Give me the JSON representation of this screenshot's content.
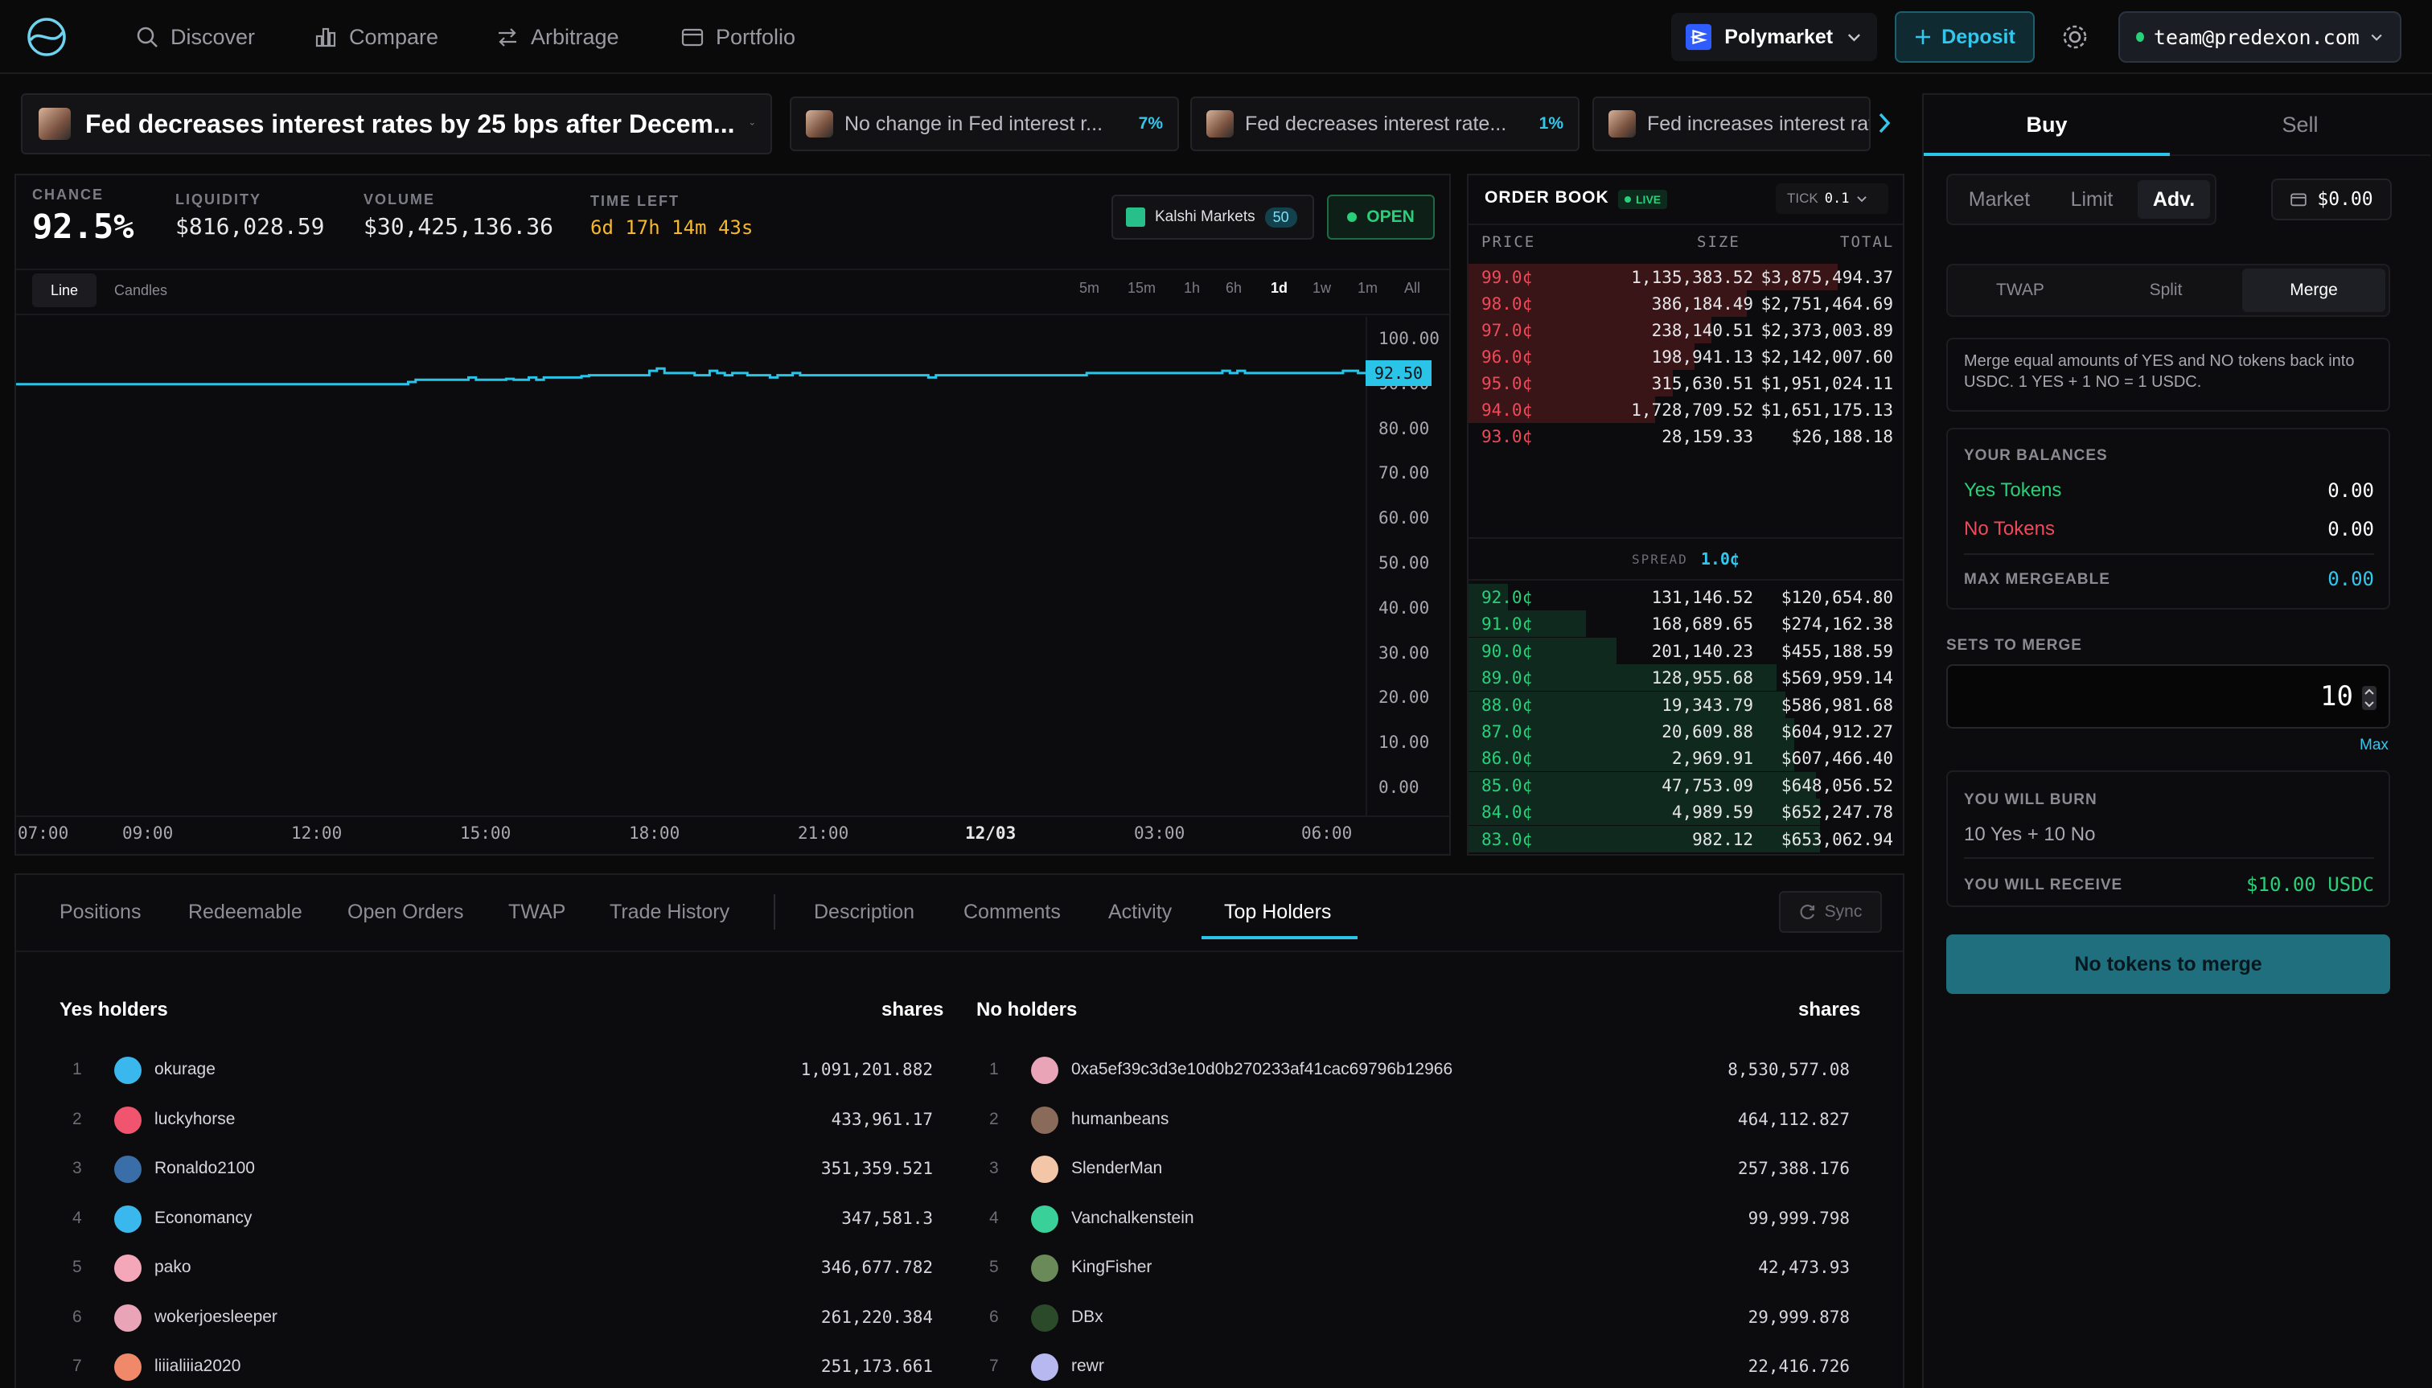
{
  "nav": {
    "links": [
      {
        "label": "Discover",
        "icon": "search-icon"
      },
      {
        "label": "Compare",
        "icon": "bar-chart-icon"
      },
      {
        "label": "Arbitrage",
        "icon": "swap-arrows-icon"
      },
      {
        "label": "Portfolio",
        "icon": "wallet-icon"
      }
    ],
    "platform": "Polymarket",
    "deposit_label": "Deposit",
    "account": "team@predexon.com"
  },
  "markets": {
    "selected": "Fed decreases interest rates by 25 bps after Decem...",
    "others": [
      {
        "title": "No change in Fed interest r...",
        "pct": "7%"
      },
      {
        "title": "Fed decreases interest rate...",
        "pct": "1%"
      },
      {
        "title": "Fed increases interest rat",
        "pct": ""
      }
    ]
  },
  "stats": {
    "chance_label": "CHANCE",
    "chance": "92.5%",
    "liquidity_label": "LIQUIDITY",
    "liquidity": "$816,028.59",
    "volume_label": "VOLUME",
    "volume": "$30,425,136.36",
    "time_label": "TIME LEFT",
    "time_left": "6d 17h 14m 43s",
    "kalshi_label": "Kalshi Markets",
    "kalshi_count": "50",
    "status": "OPEN"
  },
  "chart_controls": {
    "modes": [
      "Line",
      "Candles"
    ],
    "active_mode": "Line",
    "timeframes": [
      "5m",
      "15m",
      "1h",
      "6h",
      "1d",
      "1w",
      "1m",
      "All"
    ],
    "active_timeframe": "1d"
  },
  "chart_data": {
    "type": "line",
    "title": "",
    "xlabel": "",
    "ylabel": "",
    "x_ticks": [
      "07:00",
      "09:00",
      "12:00",
      "15:00",
      "18:00",
      "21:00",
      "12/03",
      "03:00",
      "06:00"
    ],
    "y_ticks": [
      "100.00",
      "90.00",
      "80.00",
      "70.00",
      "60.00",
      "50.00",
      "40.00",
      "30.00",
      "20.00",
      "10.00",
      "0.00"
    ],
    "ylim": [
      0,
      100
    ],
    "color": "#29c4e8",
    "current_value_label": "92.50",
    "series": [
      {
        "values": [
          90.0,
          90.0,
          90.0,
          90.0,
          90.0,
          90.0,
          90.0,
          90.0,
          90.0,
          90.0,
          90.0,
          90.0,
          90.0,
          90.0,
          90.0,
          90.0,
          90.0,
          90.0,
          90.0,
          90.0,
          90.0,
          90.0,
          90.0,
          90.0,
          90.0,
          90.0,
          90.0,
          90.0,
          90.0,
          90.0,
          90.0,
          90.0,
          90.0,
          90.0,
          90.0,
          90.0,
          90.0,
          90.0,
          90.0,
          90.0,
          90.0,
          90.0,
          90.0,
          90.0,
          90.0,
          90.0,
          90.0,
          90.0,
          90.0,
          90.0,
          90.0,
          90.0,
          90.5,
          91.0,
          91.0,
          91.0,
          91.0,
          91.0,
          91.0,
          91.0,
          91.5,
          91.0,
          91.0,
          91.0,
          91.0,
          91.2,
          91.0,
          91.0,
          91.5,
          91.0,
          91.5,
          91.5,
          91.5,
          91.5,
          91.5,
          91.8,
          92.0,
          92.0,
          92.0,
          92.0,
          92.0,
          92.0,
          92.0,
          92.0,
          93.0,
          93.5,
          92.5,
          92.5,
          92.5,
          92.5,
          92.0,
          92.0,
          93.0,
          92.5,
          92.0,
          92.5,
          92.5,
          92.0,
          92.0,
          92.0,
          91.5,
          92.0,
          92.0,
          92.5,
          92.0,
          92.0,
          92.0,
          92.0,
          92.0,
          92.0,
          92.0,
          92.0,
          92.0,
          92.0,
          92.0,
          92.0,
          92.0,
          92.0,
          92.0,
          92.0,
          92.0,
          91.5,
          92.0,
          92.0,
          92.0,
          92.0,
          92.0,
          92.0,
          92.0,
          92.0,
          92.0,
          92.0,
          92.0,
          92.0,
          92.0,
          92.0,
          92.0,
          92.0,
          92.0,
          92.0,
          92.0,
          92.0,
          92.5,
          92.5,
          92.5,
          92.5,
          92.5,
          92.5,
          92.5,
          92.5,
          92.5,
          92.5,
          92.5,
          92.5,
          92.5,
          92.5,
          92.5,
          92.5,
          92.5,
          92.5,
          93.0,
          92.5,
          93.0,
          92.5,
          92.5,
          92.5,
          92.5,
          92.5,
          92.5,
          92.5,
          92.5,
          92.5,
          92.5,
          92.5,
          92.5,
          92.5,
          93.0,
          93.0,
          92.5,
          92.5
        ]
      }
    ]
  },
  "orderbook": {
    "title": "ORDER BOOK",
    "live": "LIVE",
    "tick_label": "TICK",
    "tick": "0.1",
    "headers": [
      "PRICE",
      "SIZE",
      "TOTAL"
    ],
    "asks": [
      {
        "price": "99.0¢",
        "size": "1,135,383.52",
        "total": "$3,875,494.37",
        "depth": 0.85
      },
      {
        "price": "98.0¢",
        "size": "386,184.49",
        "total": "$2,751,464.69",
        "depth": 0.64
      },
      {
        "price": "97.0¢",
        "size": "238,140.51",
        "total": "$2,373,003.89",
        "depth": 0.56
      },
      {
        "price": "96.0¢",
        "size": "198,941.13",
        "total": "$2,142,007.60",
        "depth": 0.52
      },
      {
        "price": "95.0¢",
        "size": "315,630.51",
        "total": "$1,951,024.11",
        "depth": 0.47
      },
      {
        "price": "94.0¢",
        "size": "1,728,709.52",
        "total": "$1,651,175.13",
        "depth": 0.43
      },
      {
        "price": "93.0¢",
        "size": "28,159.33",
        "total": "$26,188.18",
        "depth": 0.0
      }
    ],
    "spread_label": "SPREAD",
    "spread": "1.0¢",
    "bids": [
      {
        "price": "92.0¢",
        "size": "131,146.52",
        "total": "$120,654.80",
        "depth": 0.09
      },
      {
        "price": "91.0¢",
        "size": "168,689.65",
        "total": "$274,162.38",
        "depth": 0.27
      },
      {
        "price": "90.0¢",
        "size": "201,140.23",
        "total": "$455,188.59",
        "depth": 0.34
      },
      {
        "price": "89.0¢",
        "size": "128,955.68",
        "total": "$569,959.14",
        "depth": 0.71
      },
      {
        "price": "88.0¢",
        "size": "19,343.79",
        "total": "$586,981.68",
        "depth": 0.73
      },
      {
        "price": "87.0¢",
        "size": "20,609.88",
        "total": "$604,912.27",
        "depth": 0.75
      },
      {
        "price": "86.0¢",
        "size": "2,969.91",
        "total": "$607,466.40",
        "depth": 0.75
      },
      {
        "price": "85.0¢",
        "size": "47,753.09",
        "total": "$648,056.52",
        "depth": 0.8
      },
      {
        "price": "84.0¢",
        "size": "4,989.59",
        "total": "$652,247.78",
        "depth": 0.81
      },
      {
        "price": "83.0¢",
        "size": "982.12",
        "total": "$653,062.94",
        "depth": 0.81
      }
    ]
  },
  "tabs": {
    "left": [
      "Positions",
      "Redeemable",
      "Open Orders",
      "TWAP",
      "Trade History"
    ],
    "right": [
      "Description",
      "Comments",
      "Activity",
      "Top Holders"
    ],
    "active": "Top Holders",
    "sync_label": "Sync"
  },
  "holders": {
    "yes_title": "Yes holders",
    "no_title": "No holders",
    "shares_label": "shares",
    "yes": [
      {
        "rank": "1",
        "name": "okurage",
        "shares": "1,091,201.882",
        "color": "#3ab8ee"
      },
      {
        "rank": "2",
        "name": "luckyhorse",
        "shares": "433,961.17",
        "color": "#f0546e"
      },
      {
        "rank": "3",
        "name": "Ronaldo2100",
        "shares": "351,359.521",
        "color": "#3a6ea8"
      },
      {
        "rank": "4",
        "name": "Economancy",
        "shares": "347,581.3",
        "color": "#3ab8ee"
      },
      {
        "rank": "5",
        "name": "pako",
        "shares": "346,677.782",
        "color": "#f4a7b9"
      },
      {
        "rank": "6",
        "name": "wokerjoesleeper",
        "shares": "261,220.384",
        "color": "#e9a4b8"
      },
      {
        "rank": "7",
        "name": "liiialiiia2020",
        "shares": "251,173.661",
        "color": "#f0886a"
      }
    ],
    "no": [
      {
        "rank": "1",
        "name": "0xa5ef39c3d3e10d0b270233af41cac69796b12966",
        "shares": "8,530,577.08",
        "color": "#e9a4b8"
      },
      {
        "rank": "2",
        "name": "humanbeans",
        "shares": "464,112.827",
        "color": "#8a6a58"
      },
      {
        "rank": "3",
        "name": "SlenderMan",
        "shares": "257,388.176",
        "color": "#f4c6a8"
      },
      {
        "rank": "4",
        "name": "Vanchalkenstein",
        "shares": "99,999.798",
        "color": "#3ad09a"
      },
      {
        "rank": "5",
        "name": "KingFisher",
        "shares": "42,473.93",
        "color": "#6a8a5a"
      },
      {
        "rank": "6",
        "name": "DBx",
        "shares": "29,999.878",
        "color": "#2a4a2a"
      },
      {
        "rank": "7",
        "name": "rewr",
        "shares": "22,416.726",
        "color": "#b8b8f0"
      }
    ]
  },
  "trade": {
    "side_tabs": [
      "Buy",
      "Sell"
    ],
    "active_side": "Buy",
    "order_types": [
      "Market",
      "Limit",
      "Adv."
    ],
    "active_order_type": "Adv.",
    "balance": "$0.00",
    "adv_modes": [
      "TWAP",
      "Split",
      "Merge"
    ],
    "active_adv_mode": "Merge",
    "merge_desc": "Merge equal amounts of YES and NO tokens back into USDC. 1 YES + 1 NO = 1 USDC.",
    "balances_label": "YOUR BALANCES",
    "yes_tokens_label": "Yes Tokens",
    "yes_tokens": "0.00",
    "no_tokens_label": "No Tokens",
    "no_tokens": "0.00",
    "max_mergeable_label": "MAX MERGEABLE",
    "max_mergeable": "0.00",
    "sets_label": "SETS TO MERGE",
    "sets_value": "10",
    "max_label": "Max",
    "burn_label": "YOU WILL BURN",
    "burn_value": "10 Yes + 10 No",
    "receive_label": "YOU WILL RECEIVE",
    "receive_value": "$10.00 USDC",
    "submit_label": "No tokens to merge"
  },
  "colors": {
    "accent": "#29c4e8",
    "ask": "#ef4a5a",
    "bid": "#29d07a",
    "time": "#f5b82e"
  }
}
